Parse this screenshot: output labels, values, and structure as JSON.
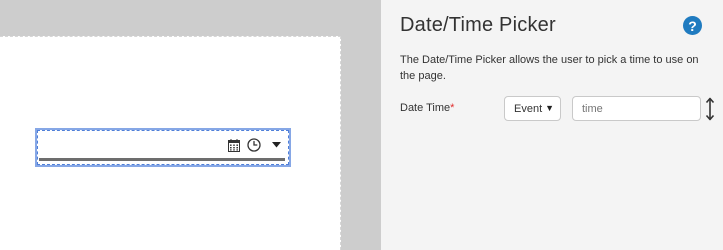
{
  "canvas": {
    "widget": {
      "icons": [
        "calendar-icon",
        "clock-icon",
        "caret-down-icon"
      ]
    }
  },
  "panel": {
    "title": "Date/Time Picker",
    "help_symbol": "?",
    "description": "The Date/Time Picker allows the user to pick a time to use on the page.",
    "field": {
      "label": "Date Time",
      "required_mark": "*",
      "type_select": {
        "value": "Event"
      },
      "value_input": {
        "placeholder": "time",
        "value": ""
      }
    }
  },
  "colors": {
    "help_icon": "#1f7bc0",
    "required": "#e02b2b",
    "selection_border": "#4f7fd9",
    "underline": "#6d6d6d"
  }
}
